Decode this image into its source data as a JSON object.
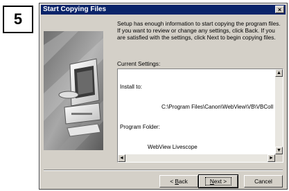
{
  "step_number": "5",
  "window": {
    "title": "Start Copying Files",
    "close_glyph": "×"
  },
  "intro_text": "Setup has enough information to start copying the program files. If you want to review or change any settings, click Back.  If you are satisfied with the settings, click Next to begin copying files.",
  "current_settings": {
    "label": "Current Settings:",
    "lines": [
      "Install to:",
      "C:\\Program Files\\Canon\\WebView\\VB\\VBCollector",
      "Program Folder:",
      "WebView Livescope"
    ]
  },
  "buttons": {
    "back": {
      "prefix": "< ",
      "mnemonic": "B",
      "rest": "ack"
    },
    "next": {
      "mnemonic": "N",
      "rest": "ext >"
    },
    "cancel": "Cancel"
  },
  "icons": {
    "scroll_up": "▲",
    "scroll_down": "▼",
    "scroll_left": "◄",
    "scroll_right": "►"
  }
}
